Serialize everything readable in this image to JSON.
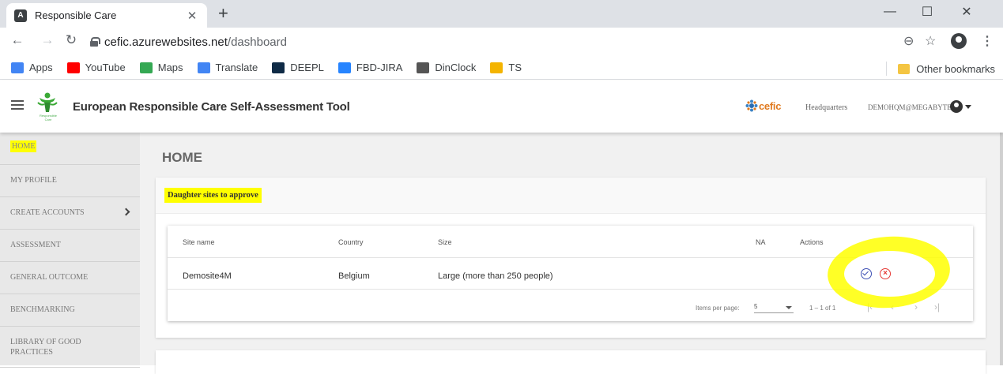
{
  "browser": {
    "tab_title": "Responsible Care",
    "tab_favicon": "A",
    "url_host": "cefic.azurewebsites.net",
    "url_path": "/dashboard",
    "bookmarks": [
      {
        "label": "Apps",
        "icon": "apps-grid-icon",
        "color": "#4285f4"
      },
      {
        "label": "YouTube",
        "icon": "youtube-icon",
        "color": "#ff0000"
      },
      {
        "label": "Maps",
        "icon": "maps-icon",
        "color": "#34a853"
      },
      {
        "label": "Translate",
        "icon": "translate-icon",
        "color": "#4285f4"
      },
      {
        "label": "DEEPL",
        "icon": "deepl-icon",
        "color": "#0f2b46"
      },
      {
        "label": "FBD-JIRA",
        "icon": "jira-icon",
        "color": "#2684ff"
      },
      {
        "label": "DinClock",
        "icon": "hourglass-icon",
        "color": "#555555"
      },
      {
        "label": "TS",
        "icon": "ts-icon",
        "color": "#f4b400"
      }
    ],
    "other_bookmarks": "Other bookmarks"
  },
  "header": {
    "app_title": "European Responsible Care Self-Assessment Tool",
    "logo_caption": "Responsible Care",
    "cefic_text": "cefic",
    "location": "Headquarters",
    "user_email": "DEMOHQM@MEGABYTE.BE"
  },
  "sidebar": {
    "items": [
      {
        "label": "HOME"
      },
      {
        "label": "MY PROFILE"
      },
      {
        "label": "CREATE ACCOUNTS"
      },
      {
        "label": "ASSESSMENT"
      },
      {
        "label": "GENERAL OUTCOME"
      },
      {
        "label": "BENCHMARKING"
      },
      {
        "label": "LIBRARY OF GOOD PRACTICES"
      }
    ]
  },
  "main": {
    "heading": "HOME",
    "card_title": "Daughter sites to approve",
    "table": {
      "columns": [
        "Site name",
        "Country",
        "Size",
        "NA",
        "Actions"
      ],
      "rows": [
        {
          "site_name": "Demosite4M",
          "country": "Belgium",
          "size": "Large (more than 250 people)",
          "na": ""
        }
      ]
    },
    "paginator": {
      "items_per_page_label": "Items per page:",
      "items_per_page": "5",
      "range": "1 – 1 of 1"
    }
  },
  "colors": {
    "highlight": "#ffff00",
    "approve": "#3f51b5",
    "reject": "#e53935",
    "cefic_orange": "#e07a1f"
  }
}
